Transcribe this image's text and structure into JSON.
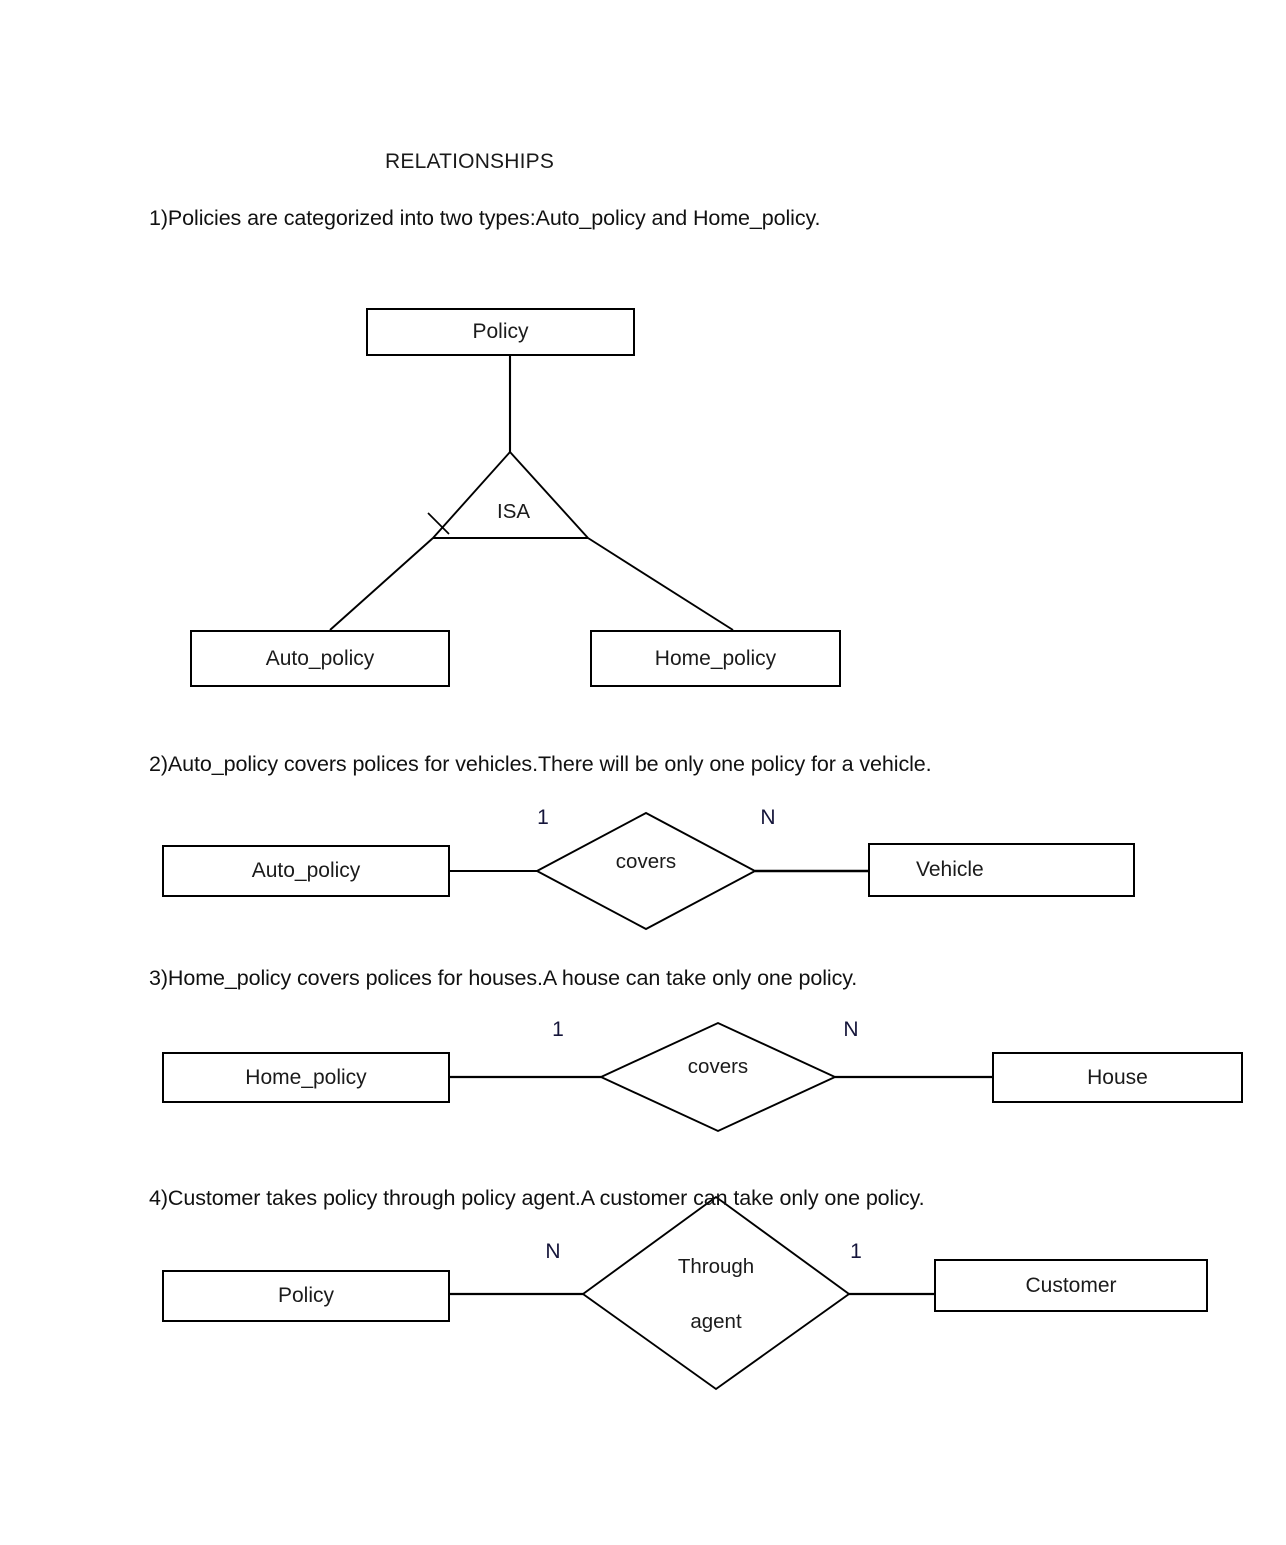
{
  "document": {
    "title": "RELATIONSHIPS"
  },
  "sections": [
    {
      "caption": "1)Policies are categorized into two types:Auto_policy and Home_policy.",
      "diagram_type": "isa-hierarchy",
      "supertype": "Policy",
      "isa_label": "ISA",
      "subtypes": [
        "Auto_policy",
        "Home_policy"
      ]
    },
    {
      "caption": "2)Auto_policy covers polices for vehicles.There will be only one policy for a vehicle.",
      "diagram_type": "binary-relationship",
      "left_entity": "Auto_policy",
      "relationship": "covers",
      "right_entity": "Vehicle",
      "left_cardinality": "1",
      "right_cardinality": "N"
    },
    {
      "caption": "3)Home_policy covers polices for houses.A house can take only one policy.",
      "diagram_type": "binary-relationship",
      "left_entity": "Home_policy",
      "relationship": "covers",
      "right_entity": "House",
      "left_cardinality": "1",
      "right_cardinality": "N"
    },
    {
      "caption": "4)Customer takes policy through policy agent.A customer can take only one policy.",
      "diagram_type": "binary-relationship",
      "left_entity": "Policy",
      "relationship_line1": "Through",
      "relationship_line2": "agent",
      "right_entity": "Customer",
      "left_cardinality": "N",
      "right_cardinality": "1"
    }
  ],
  "colors": {
    "page_background": "#ffffff",
    "stroke": "#000000",
    "text": "#1a1a1a"
  }
}
